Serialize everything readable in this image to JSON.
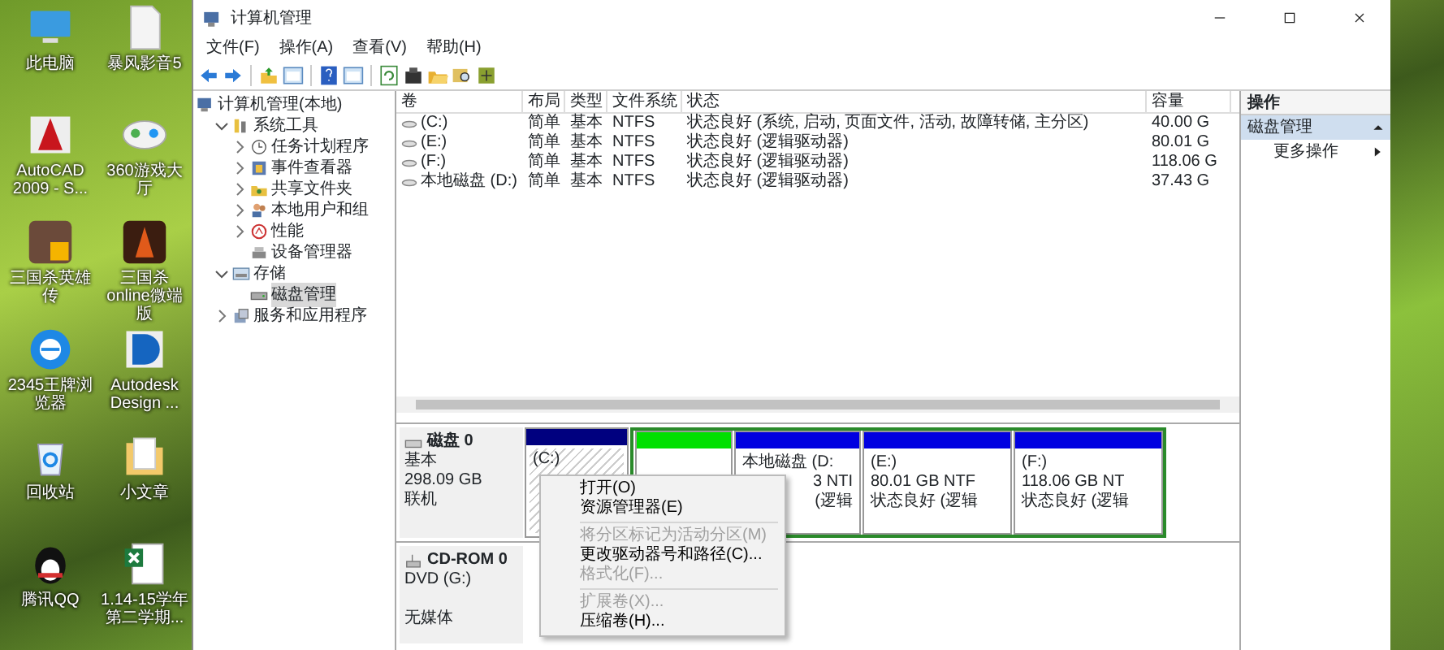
{
  "desktop_icons": [
    {
      "label": "此电脑",
      "kind": "monitor"
    },
    {
      "label": "暴风影音5",
      "kind": "document"
    },
    {
      "label": "AutoCAD 2009 - S...",
      "kind": "cad"
    },
    {
      "label": "360游戏大厅",
      "kind": "gamepad"
    },
    {
      "label": "三国杀英雄传",
      "kind": "game"
    },
    {
      "label": "三国杀online微端版",
      "kind": "game2"
    },
    {
      "label": "2345王牌浏览器",
      "kind": "browser"
    },
    {
      "label": "Autodesk Design ...",
      "kind": "design"
    },
    {
      "label": "回收站",
      "kind": "recycle"
    },
    {
      "label": "小文章",
      "kind": "folder"
    },
    {
      "label": "腾讯QQ",
      "kind": "penguin"
    },
    {
      "label": "1.14-15学年第二学期...",
      "kind": "spreadsheet"
    }
  ],
  "window": {
    "title": "计算机管理"
  },
  "menu": [
    "文件(F)",
    "操作(A)",
    "查看(V)",
    "帮助(H)"
  ],
  "tree": [
    {
      "label": "计算机管理(本地)",
      "kind": "computer",
      "selected": false,
      "children": [
        {
          "label": "系统工具",
          "kind": "tools",
          "selected": false,
          "expanded": true,
          "children": [
            {
              "label": "任务计划程序",
              "kind": "clock",
              "selected": false,
              "expanded": false
            },
            {
              "label": "事件查看器",
              "kind": "viewer",
              "selected": false,
              "expanded": false
            },
            {
              "label": "共享文件夹",
              "kind": "share",
              "selected": false,
              "expanded": false
            },
            {
              "label": "本地用户和组",
              "kind": "users",
              "selected": false,
              "expanded": false
            },
            {
              "label": "性能",
              "kind": "perf",
              "selected": false,
              "expanded": false
            },
            {
              "label": "设备管理器",
              "kind": "device",
              "selected": false
            }
          ]
        },
        {
          "label": "存储",
          "kind": "storage",
          "selected": false,
          "expanded": true,
          "children": [
            {
              "label": "磁盘管理",
              "kind": "disk",
              "selected": true
            }
          ]
        },
        {
          "label": "服务和应用程序",
          "kind": "services",
          "selected": false,
          "expanded": false
        }
      ]
    }
  ],
  "volumes": {
    "columns": [
      "卷",
      "布局",
      "类型",
      "文件系统",
      "状态",
      "容量"
    ],
    "rows": [
      {
        "volume": "(C:)",
        "layout": "简单",
        "type": "基本",
        "fs": "NTFS",
        "status": "状态良好 (系统, 启动, 页面文件, 活动, 故障转储, 主分区)",
        "capacity": "40.00 G"
      },
      {
        "volume": "(E:)",
        "layout": "简单",
        "type": "基本",
        "fs": "NTFS",
        "status": "状态良好 (逻辑驱动器)",
        "capacity": "80.01 G"
      },
      {
        "volume": "(F:)",
        "layout": "简单",
        "type": "基本",
        "fs": "NTFS",
        "status": "状态良好 (逻辑驱动器)",
        "capacity": "118.06 G"
      },
      {
        "volume": "本地磁盘 (D:)",
        "layout": "简单",
        "type": "基本",
        "fs": "NTFS",
        "status": "状态良好 (逻辑驱动器)",
        "capacity": "37.43 G"
      }
    ]
  },
  "disks": [
    {
      "name": "磁盘 0",
      "kind": "disk",
      "lines": [
        "基本",
        "298.09 GB",
        "联机"
      ],
      "partitions": [
        {
          "kind": "primary",
          "selected": true,
          "title": "(C:)"
        },
        {
          "kind": "extended",
          "children": [
            {
              "kind": "free",
              "selected": false
            },
            {
              "kind": "logical",
              "selected": false,
              "title": "本地磁盘  (D:",
              "lines": [
                "3 NTI",
                "(逻辑"
              ]
            },
            {
              "kind": "logical",
              "selected": false,
              "title": "(E:)",
              "lines": [
                "80.01 GB NTF",
                "状态良好 (逻辑"
              ]
            },
            {
              "kind": "logical",
              "selected": false,
              "title": "(F:)",
              "lines": [
                "118.06 GB NT",
                "状态良好 (逻辑"
              ]
            }
          ]
        }
      ]
    },
    {
      "name": "CD-ROM 0",
      "kind": "cdrom",
      "lines": [
        "DVD (G:)"
      ],
      "status": "无媒体"
    }
  ],
  "context_menu": [
    {
      "label": "打开(O)",
      "disabled": false
    },
    {
      "label": "资源管理器(E)",
      "disabled": false
    },
    {
      "kind": "separator"
    },
    {
      "label": "将分区标记为活动分区(M)",
      "disabled": true
    },
    {
      "label": "更改驱动器号和路径(C)...",
      "disabled": false
    },
    {
      "label": "格式化(F)...",
      "disabled": true
    },
    {
      "kind": "separator"
    },
    {
      "label": "扩展卷(X)...",
      "disabled": true
    },
    {
      "label": "压缩卷(H)...",
      "disabled": false
    }
  ],
  "actions": {
    "header": "操作",
    "section": {
      "label": "磁盘管理",
      "expanded": true
    },
    "items": [
      {
        "label": "更多操作"
      }
    ]
  }
}
